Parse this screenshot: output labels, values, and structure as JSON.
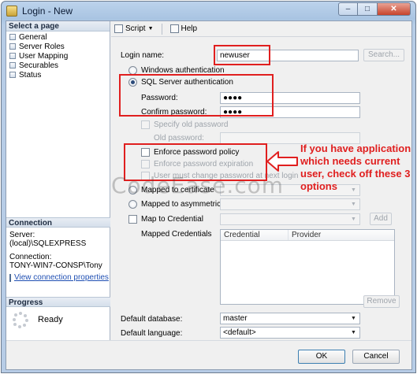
{
  "window": {
    "title": "Login - New",
    "minimize": "–",
    "maximize": "□",
    "close": "✕"
  },
  "sidebar": {
    "header": "Select a page",
    "items": [
      {
        "label": "General",
        "icon": "page-icon"
      },
      {
        "label": "Server Roles",
        "icon": "page-icon"
      },
      {
        "label": "User Mapping",
        "icon": "page-icon"
      },
      {
        "label": "Securables",
        "icon": "page-icon"
      },
      {
        "label": "Status",
        "icon": "page-icon"
      }
    ]
  },
  "connection": {
    "header": "Connection",
    "server_label": "Server:",
    "server_value": "(local)\\SQLEXPRESS",
    "connection_label": "Connection:",
    "connection_value": "TONY-WIN7-CONSP\\Tony",
    "link": "View connection properties"
  },
  "progress": {
    "header": "Progress",
    "status": "Ready"
  },
  "toolbar": {
    "script": "Script",
    "help": "Help"
  },
  "form": {
    "login_name_label": "Login name:",
    "login_name_value": "newuser",
    "search_button": "Search...",
    "windows_auth": "Windows authentication",
    "sql_auth": "SQL Server authentication",
    "password_label": "Password:",
    "password_value": "●●●●",
    "confirm_label": "Confirm password:",
    "confirm_value": "●●●●",
    "specify_old": "Specify old password",
    "old_password_label": "Old password:",
    "enforce_policy": "Enforce password policy",
    "enforce_expiration": "Enforce password expiration",
    "must_change": "User must change password at next login",
    "mapped_certificate": "Mapped to certificate",
    "mapped_asym": "Mapped to asymmetric key",
    "map_credential": "Map to Credential",
    "add_button": "Add",
    "mapped_credentials_label": "Mapped Credentials",
    "grid_cols": [
      "Credential",
      "Provider"
    ],
    "remove_button": "Remove",
    "default_db_label": "Default database:",
    "default_db_value": "master",
    "default_lang_label": "Default language:",
    "default_lang_value": "<default>"
  },
  "annotation": {
    "lines": [
      "If you have application",
      "which needs current",
      "user, check off these 3",
      "options"
    ],
    "color": "#e01f1f"
  },
  "watermark": "CodeEase.com",
  "footer": {
    "ok": "OK",
    "cancel": "Cancel"
  }
}
